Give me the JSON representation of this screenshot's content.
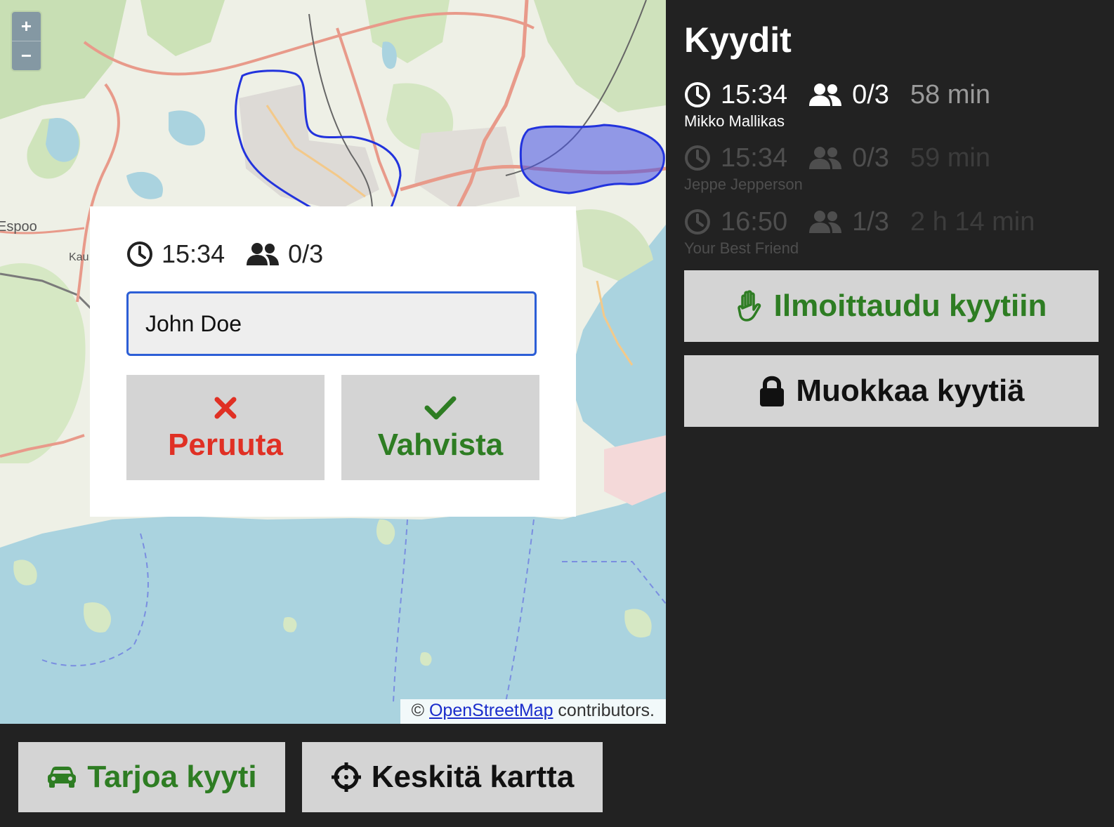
{
  "map": {
    "zoom_in": "+",
    "zoom_out": "−",
    "attribution_prefix": "© ",
    "attribution_link": "OpenStreetMap",
    "attribution_suffix": " contributors.",
    "place_labels": [
      "Espoo",
      "Kau"
    ]
  },
  "popup": {
    "time": "15:34",
    "seats": "0/3",
    "name_value": "John Doe",
    "cancel_label": "Peruuta",
    "confirm_label": "Vahvista",
    "icons": [
      "clock-icon",
      "users-icon",
      "x-icon",
      "check-icon"
    ]
  },
  "bottom": {
    "offer_label": "Tarjoa kyyti",
    "center_label": "Keskitä kartta",
    "icons": [
      "car-icon",
      "crosshair-icon"
    ]
  },
  "sidebar": {
    "title": "Kyydit",
    "rides": [
      {
        "time": "15:34",
        "seats": "0/3",
        "duration": "58 min",
        "driver": "Mikko Mallikas",
        "active": true
      },
      {
        "time": "15:34",
        "seats": "0/3",
        "duration": "59 min",
        "driver": "Jeppe Jepperson",
        "active": false
      },
      {
        "time": "16:50",
        "seats": "1/3",
        "duration": "2 h 14 min",
        "driver": "Your Best Friend",
        "active": false
      }
    ],
    "join_label": "Ilmoittaudu kyytiin",
    "edit_label": "Muokkaa kyytiä",
    "icons": [
      "hand-icon",
      "lock-icon"
    ]
  },
  "colors": {
    "sidebar_bg": "#222222",
    "button_bg": "#d4d4d4",
    "green": "#2e7d23",
    "red": "#e03024",
    "input_border": "#2c5ed6",
    "area_outline": "#2233dd"
  }
}
